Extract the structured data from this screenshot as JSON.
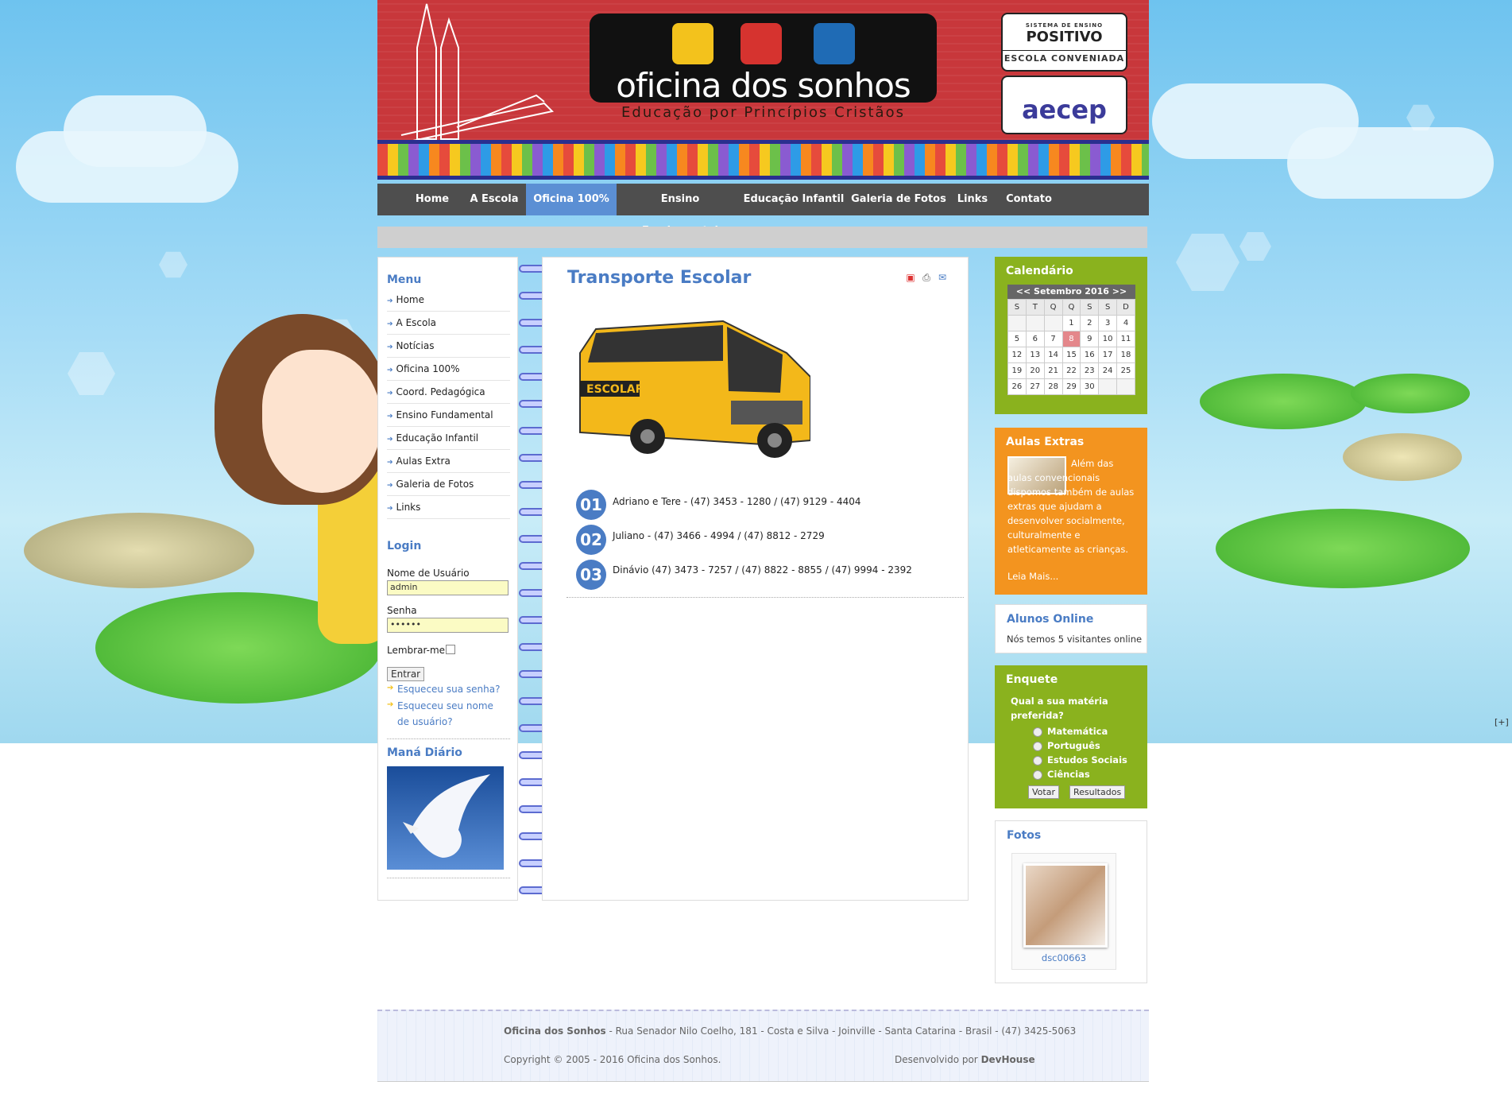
{
  "site": {
    "logo_title": "oficina dos sonhos",
    "logo_subtitle": "Educação por Princípios Cristãos",
    "badge1_small": "SISTEMA DE ENSINO",
    "badge1_big": "POSITIVO",
    "badge1_sub": "ESCOLA CONVENIADA",
    "badge2_text": "aecep"
  },
  "nav": {
    "items": [
      "Home",
      "A Escola",
      "Oficina 100%",
      "Ensino Fundamental",
      "Educação Infantil",
      "Galeria de Fotos",
      "Links",
      "Contato"
    ],
    "active": "Oficina 100%"
  },
  "left": {
    "menu_title": "Menu",
    "menu": [
      "Home",
      "A Escola",
      "Notícias",
      "Oficina 100%",
      "Coord. Pedagógica",
      "Ensino Fundamental",
      "Educação Infantil",
      "Aulas Extra",
      "Galeria de Fotos",
      "Links"
    ],
    "login_title": "Login",
    "user_label": "Nome de Usuário",
    "user_value": "admin",
    "pass_label": "Senha",
    "pass_value": "••••••",
    "remember_label": "Lembrar-me",
    "submit_label": "Entrar",
    "forgot_pass": "Esqueceu sua senha?",
    "forgot_user": "Esqueceu seu nome de usuário?",
    "mana_title": "Maná Diário"
  },
  "content": {
    "title": "Transporte Escolar",
    "bus_label": "ESCOLAR",
    "contacts": [
      {
        "num": "01",
        "text": "Adriano e Tere - (47) 3453 - 1280 / (47) 9129 - 4404"
      },
      {
        "num": "02",
        "text": "Juliano  - (47) 3466 - 4994 / (47) 8812 - 2729"
      },
      {
        "num": "03",
        "text": "Dinávio (47) 3473 - 7257 / (47) 8822 - 8855 / (47) 9994 - 2392"
      }
    ]
  },
  "calendar": {
    "title": "Calendário",
    "month": "<< Setembro 2016 >>",
    "weekdays": [
      "S",
      "T",
      "Q",
      "Q",
      "S",
      "S",
      "D"
    ],
    "weeks": [
      [
        "",
        "",
        "",
        "1",
        "2",
        "3",
        "4"
      ],
      [
        "5",
        "6",
        "7",
        "8",
        "9",
        "10",
        "11"
      ],
      [
        "12",
        "13",
        "14",
        "15",
        "16",
        "17",
        "18"
      ],
      [
        "19",
        "20",
        "21",
        "22",
        "23",
        "24",
        "25"
      ],
      [
        "26",
        "27",
        "28",
        "29",
        "30",
        "",
        ""
      ]
    ],
    "today": "8"
  },
  "aulas": {
    "title": "Aulas Extras",
    "text": "Além das aulas convencionais dispomos também de aulas extras que ajudam a desenvolver socialmente, culturalmente e atleticamente as crianças.",
    "more": "Leia Mais..."
  },
  "online": {
    "title": "Alunos Online",
    "text": "Nós temos 5 visitantes online"
  },
  "enquete": {
    "title": "Enquete",
    "question": "Qual a sua matéria preferida?",
    "options": [
      "Matemática",
      "Português",
      "Estudos Sociais",
      "Ciências"
    ],
    "vote": "Votar",
    "results": "Resultados"
  },
  "fotos": {
    "title": "Fotos",
    "caption": "dsc00663"
  },
  "side_toggle": "[+]",
  "footer": {
    "name": "Oficina dos Sonhos",
    "address": " - Rua Senador Nilo Coelho, 181 - Costa e Silva - Joinville - Santa Catarina - Brasil - (47) 3425-5063",
    "copyright": "Copyright © 2005 - 2016 Oficina dos Sonhos.",
    "dev_label": "Desenvolvido por ",
    "dev_name": "DevHouse"
  }
}
